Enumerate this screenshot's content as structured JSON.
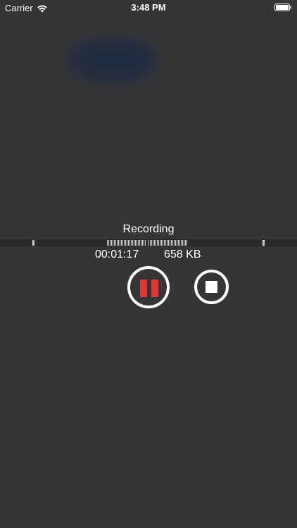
{
  "status_bar": {
    "carrier": "Carrier",
    "time": "3:48 PM",
    "icons": [
      "wifi-icon",
      "battery-icon"
    ]
  },
  "recorder": {
    "state_label": "Recording",
    "elapsed": "00:01:17",
    "file_size": "658 KB",
    "pause_icon": "pause-icon",
    "stop_icon": "stop-icon"
  },
  "colors": {
    "background": "#353535",
    "accent": "#e3342f",
    "foreground": "#ffffff"
  }
}
